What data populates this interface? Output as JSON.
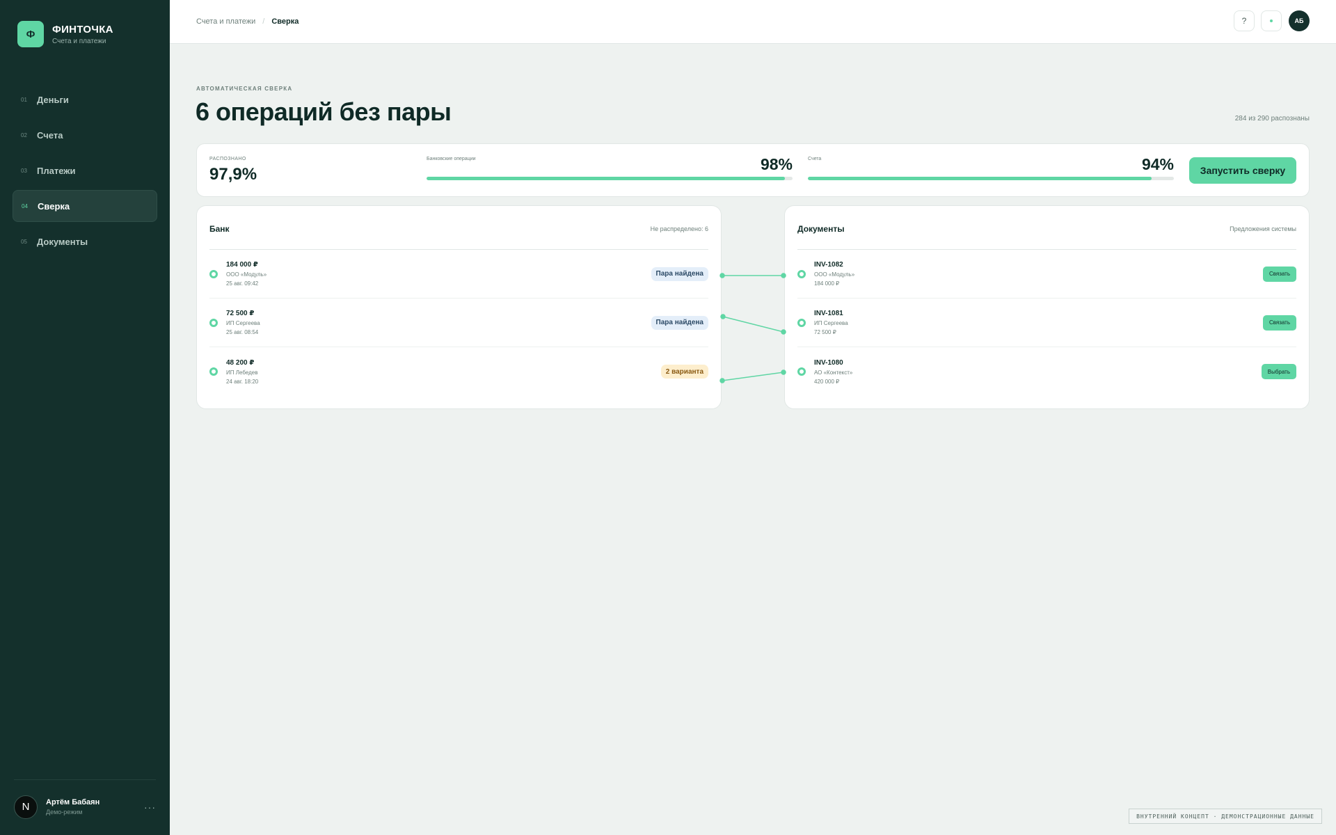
{
  "brand": {
    "logo_letter": "Ф",
    "title": "ФИНТОЧКА",
    "subtitle": "Счета и платежи"
  },
  "nav": [
    {
      "num": "01",
      "label": "Деньги",
      "active": false
    },
    {
      "num": "02",
      "label": "Счета",
      "active": false
    },
    {
      "num": "03",
      "label": "Платежи",
      "active": false
    },
    {
      "num": "04",
      "label": "Сверка",
      "active": true
    },
    {
      "num": "05",
      "label": "Документы",
      "active": false
    }
  ],
  "user": {
    "initial": "N",
    "name": "Артём Бабаян",
    "mode": "Демо-режим",
    "more": "···"
  },
  "breadcrumb": {
    "parent": "Счета и платежи",
    "sep": "/",
    "current": "Сверка"
  },
  "topbar": {
    "help": "?",
    "avatar": "АБ"
  },
  "header": {
    "eyebrow": "АВТОМАТИЧЕСКАЯ СВЕРКА",
    "title": "6 операций без пары",
    "recognized": "284 из 290 распознаны"
  },
  "stats": {
    "main_label": "РАСПОЗНАНО",
    "main_value": "97,9%",
    "bank_label": "Банковские операции",
    "bank_pct": "98%",
    "bank_fraction": 0.98,
    "invoices_label": "Счета",
    "invoices_pct": "94%",
    "invoices_fraction": 0.94,
    "run_button": "Запустить сверку"
  },
  "bank": {
    "title": "Банк",
    "meta": "Не распределено: 6",
    "rows": [
      {
        "amount": "184 000 ₽",
        "party": "ООО «Модуль»",
        "date": "25 авг. 09:42",
        "badge": "Пара найдена",
        "badge_type": "found"
      },
      {
        "amount": "72 500 ₽",
        "party": "ИП Сергеева",
        "date": "25 авг. 08:54",
        "badge": "Пара найдена",
        "badge_type": "found"
      },
      {
        "amount": "48 200 ₽",
        "party": "ИП Лебедев",
        "date": "24 авг. 18:20",
        "badge": "2 варианта",
        "badge_type": "variants"
      }
    ]
  },
  "docs": {
    "title": "Документы",
    "meta": "Предложения системы",
    "rows": [
      {
        "id": "INV-1082",
        "party": "ООО «Модуль»",
        "amount": "184 000 ₽",
        "action": "Связать"
      },
      {
        "id": "INV-1081",
        "party": "ИП Сергеева",
        "amount": "72 500 ₽",
        "action": "Связать"
      },
      {
        "id": "INV-1080",
        "party": "АО «Контекст»",
        "amount": "420 000 ₽",
        "action": "Выбрать"
      }
    ]
  },
  "footer": "ВНУТРЕННИЙ КОНЦЕПТ · ДЕМОНСТРАЦИОННЫЕ ДАННЫЕ",
  "colors": {
    "sidebar": "#14302c",
    "accent": "#5fd6a4",
    "background": "#eef2f0"
  }
}
